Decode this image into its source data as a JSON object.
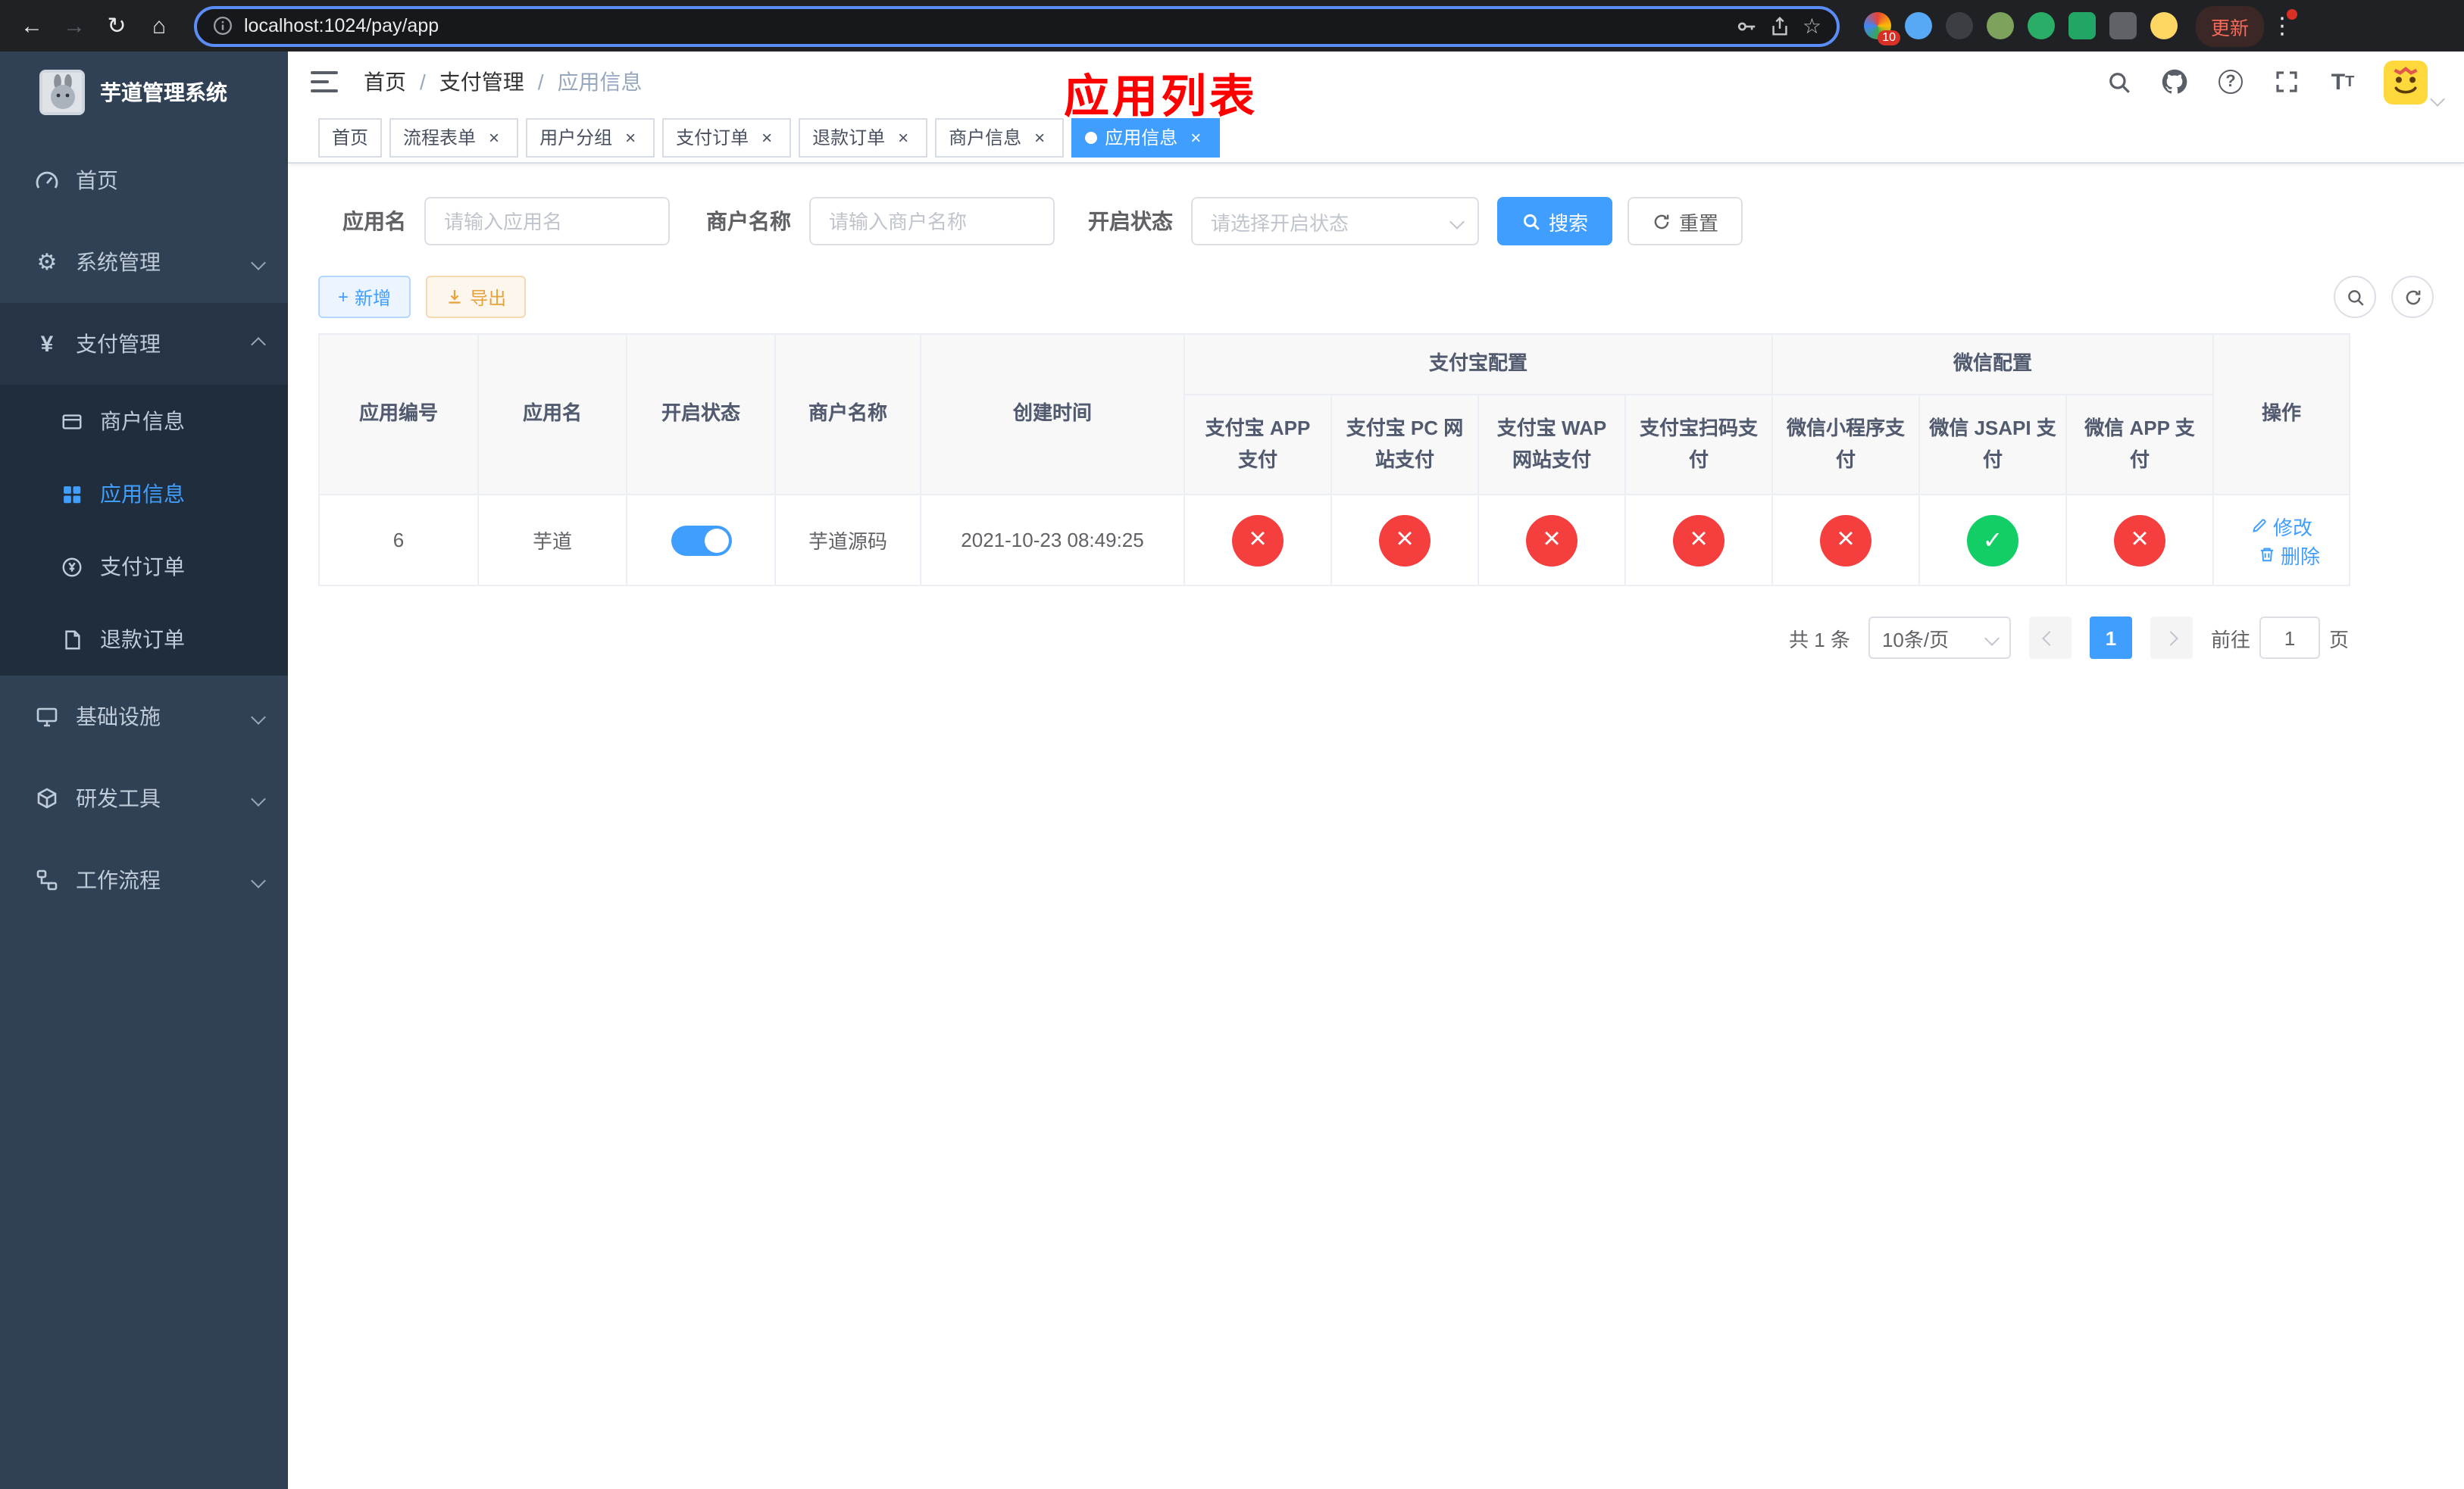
{
  "browser": {
    "url": "localhost:1024/pay/app",
    "update_label": "更新",
    "extension_badge": "10"
  },
  "sidebar": {
    "logo_title": "芋道管理系统",
    "items": [
      {
        "label": "首页"
      },
      {
        "label": "系统管理"
      },
      {
        "label": "支付管理",
        "children": [
          {
            "label": "商户信息"
          },
          {
            "label": "应用信息"
          },
          {
            "label": "支付订单"
          },
          {
            "label": "退款订单"
          }
        ]
      },
      {
        "label": "基础设施"
      },
      {
        "label": "研发工具"
      },
      {
        "label": "工作流程"
      }
    ]
  },
  "header": {
    "breadcrumb": [
      "首页",
      "支付管理",
      "应用信息"
    ],
    "annotation": "应用列表"
  },
  "tabs": [
    {
      "label": "首页"
    },
    {
      "label": "流程表单"
    },
    {
      "label": "用户分组"
    },
    {
      "label": "支付订单"
    },
    {
      "label": "退款订单"
    },
    {
      "label": "商户信息"
    },
    {
      "label": "应用信息"
    }
  ],
  "filters": {
    "app_name_label": "应用名",
    "app_name_placeholder": "请输入应用名",
    "merchant_label": "商户名称",
    "merchant_placeholder": "请输入商户名称",
    "status_label": "开启状态",
    "status_placeholder": "请选择开启状态",
    "search_label": "搜索",
    "reset_label": "重置"
  },
  "toolbar": {
    "add_label": "新增",
    "export_label": "导出"
  },
  "table": {
    "groups": {
      "alipay": "支付宝配置",
      "wechat": "微信配置"
    },
    "columns": [
      "应用编号",
      "应用名",
      "开启状态",
      "商户名称",
      "创建时间",
      "支付宝 APP 支付",
      "支付宝 PC 网站支付",
      "支付宝 WAP 网站支付",
      "支付宝扫码支付",
      "微信小程序支付",
      "微信 JSAPI 支付",
      "微信 APP 支付",
      "操作"
    ],
    "rows": [
      {
        "id": "6",
        "name": "芋道",
        "status": "on",
        "merchant": "芋道源码",
        "created": "2021-10-23 08:49:25",
        "configs": [
          "no",
          "no",
          "no",
          "no",
          "no",
          "yes",
          "no"
        ],
        "edit_label": "修改",
        "delete_label": "删除"
      }
    ]
  },
  "pagination": {
    "total_text": "共 1 条",
    "page_size": "10条/页",
    "page": "1",
    "goto_label": "前往",
    "goto_value": "1",
    "page_unit": "页"
  },
  "colors": {
    "primary": "#409eff",
    "danger": "#f53f3f",
    "success": "#13ce66",
    "annotation": "#ff0000",
    "sidebar_bg": "#304156",
    "submenu_bg": "#1f2d3d"
  }
}
